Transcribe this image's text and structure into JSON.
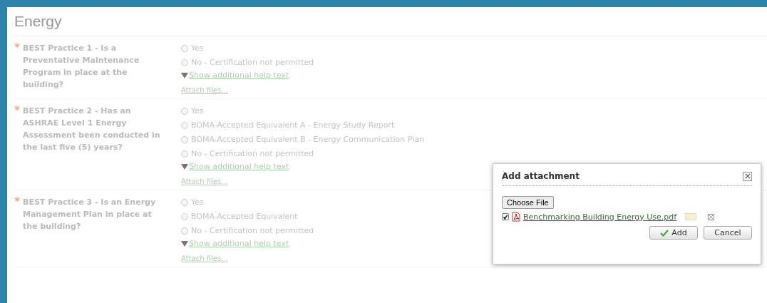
{
  "section_title": "Energy",
  "questions": [
    {
      "required_mark": "*",
      "label": "BEST Practice 1 - Is a Preventative Maintenance Program in place at the building?",
      "options": [
        {
          "label": "Yes",
          "selected": false
        },
        {
          "label": "No - Certification not permitted",
          "selected": false
        }
      ],
      "help_link": "Show additional help text",
      "attach_link": "Attach files..."
    },
    {
      "required_mark": "*",
      "label": "BEST Practice 2 - Has an ASHRAE Level 1 Energy Assessment been conducted in the last five (5) years?",
      "options": [
        {
          "label": "Yes",
          "selected": false
        },
        {
          "label": "BOMA-Accepted Equivalent A - Energy Study Report",
          "selected": false
        },
        {
          "label": "BOMA-Accepted Equivalent B - Energy Communication Plan",
          "selected": false
        },
        {
          "label": "No - Certification not permitted",
          "selected": false
        }
      ],
      "help_link": "Show additional help text",
      "attach_link": "Attach files..."
    },
    {
      "required_mark": "*",
      "label": "BEST Practice 3 - Is an Energy Management Plan in place at the building?",
      "options": [
        {
          "label": "Yes",
          "selected": false
        },
        {
          "label": "BOMA-Accepted Equivalent",
          "selected": false
        },
        {
          "label": "No - Certification not permitted",
          "selected": false
        }
      ],
      "help_link": "Show additional help text",
      "attach_link": "Attach files..."
    }
  ],
  "dialog": {
    "title": "Add attachment",
    "choose_button": "Choose File",
    "files": [
      {
        "checked": true,
        "name": "Benchmarking Building Energy Use.pdf"
      }
    ],
    "buttons": [
      {
        "kind": "primary",
        "label": "Add"
      },
      {
        "kind": "secondary",
        "label": "Cancel"
      }
    ]
  }
}
